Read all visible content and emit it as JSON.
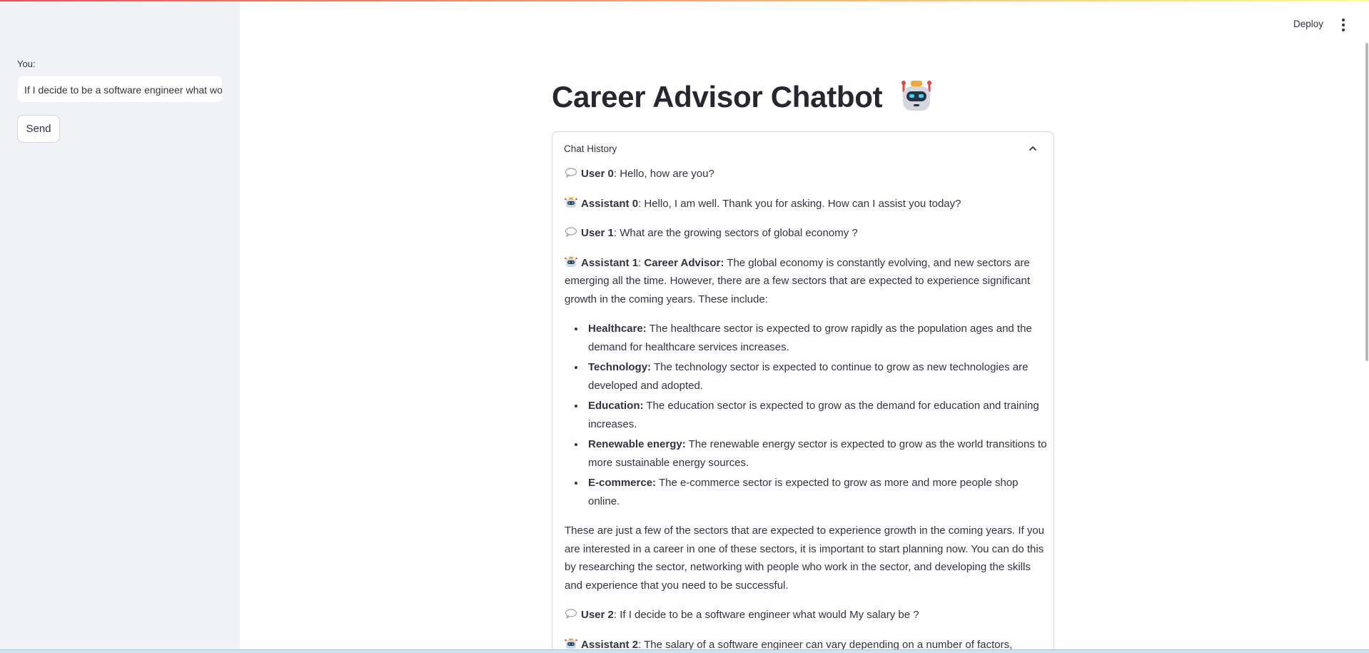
{
  "header": {
    "deploy_label": "Deploy"
  },
  "sidebar": {
    "input_label": "You:",
    "input_value": "If I decide to be a software engineer what would My salary be ?",
    "send_label": "Send"
  },
  "main": {
    "title": "Career Advisor Chatbot",
    "title_icon": "robot-icon",
    "expander_label": "Chat History",
    "messages": {
      "u0_speaker": "User 0",
      "u0_text": ": Hello, how are you?",
      "a0_speaker": "Assistant 0",
      "a0_text": ": Hello, I am well. Thank you for asking. How can I assist you today?",
      "u1_speaker": "User 1",
      "u1_text": ": What are the growing sectors of global economy ?",
      "a1_speaker": "Assistant 1",
      "a1_sep": ": ",
      "a1_bold": "Career Advisor:",
      "a1_text": " The global economy is constantly evolving, and new sectors are emerging all the time. However, there are a few sectors that are expected to experience significant growth in the coming years. These include:",
      "bullets": [
        {
          "term": "Healthcare:",
          "text": " The healthcare sector is expected to grow rapidly as the population ages and the demand for healthcare services increases."
        },
        {
          "term": "Technology:",
          "text": " The technology sector is expected to continue to grow as new technologies are developed and adopted."
        },
        {
          "term": "Education:",
          "text": " The education sector is expected to grow as the demand for education and training increases."
        },
        {
          "term": "Renewable energy:",
          "text": " The renewable energy sector is expected to grow as the world transitions to more sustainable energy sources."
        },
        {
          "term": "E-commerce:",
          "text": " The e-commerce sector is expected to grow as more and more people shop online."
        }
      ],
      "a1_closing": "These are just a few of the sectors that are expected to experience growth in the coming years. If you are interested in a career in one of these sectors, it is important to start planning now. You can do this by researching the sector, networking with people who work in the sector, and developing the skills and experience that you need to be successful.",
      "u2_speaker": "User 2",
      "u2_text": ": If I decide to be a software engineer what would My salary be ?",
      "a2_speaker": "Assistant 2",
      "a2_text": ": The salary of a software engineer can vary depending on a number of factors, including your experience, skills, and location. However, according to the U.S. Bureau of Labor"
    }
  },
  "icons": {
    "user_icon": "speech-bubble-icon",
    "assistant_icon": "robot-icon",
    "menu_icon": "kebab-menu-icon",
    "expander_icon": "chevron-up-icon"
  },
  "colors": {
    "sidebar_bg": "#f0f2f6",
    "text": "#31333f",
    "title": "#262730",
    "border": "#d6d6d9",
    "accent_gradient_start": "#ff4b4b",
    "accent_gradient_end": "#fffd80"
  }
}
